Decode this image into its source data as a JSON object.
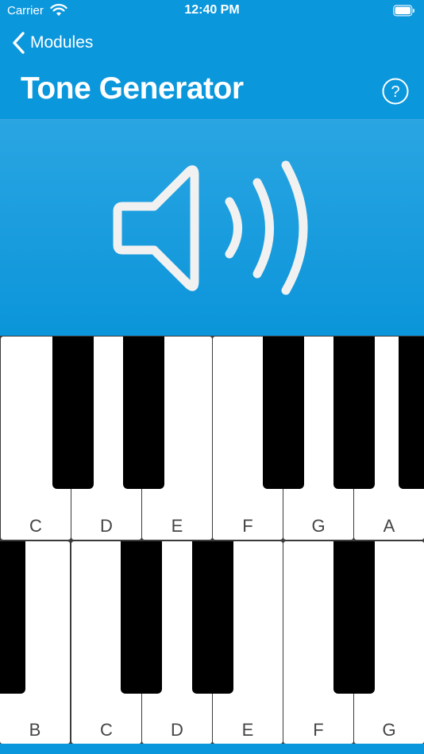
{
  "status_bar": {
    "carrier": "Carrier",
    "time": "12:40 PM"
  },
  "nav": {
    "back_label": "Modules",
    "help_symbol": "?"
  },
  "page": {
    "title": "Tone Generator"
  },
  "hero": {
    "icon": "speaker-volume-icon"
  },
  "colors": {
    "accent": "#0b97dc",
    "key_white": "#ffffff",
    "key_black": "#000000"
  },
  "keyboard": {
    "row1_keys": [
      "C",
      "D",
      "E",
      "F",
      "G",
      "A"
    ],
    "row2_keys": [
      "B",
      "C",
      "D",
      "E",
      "F",
      "G"
    ]
  }
}
